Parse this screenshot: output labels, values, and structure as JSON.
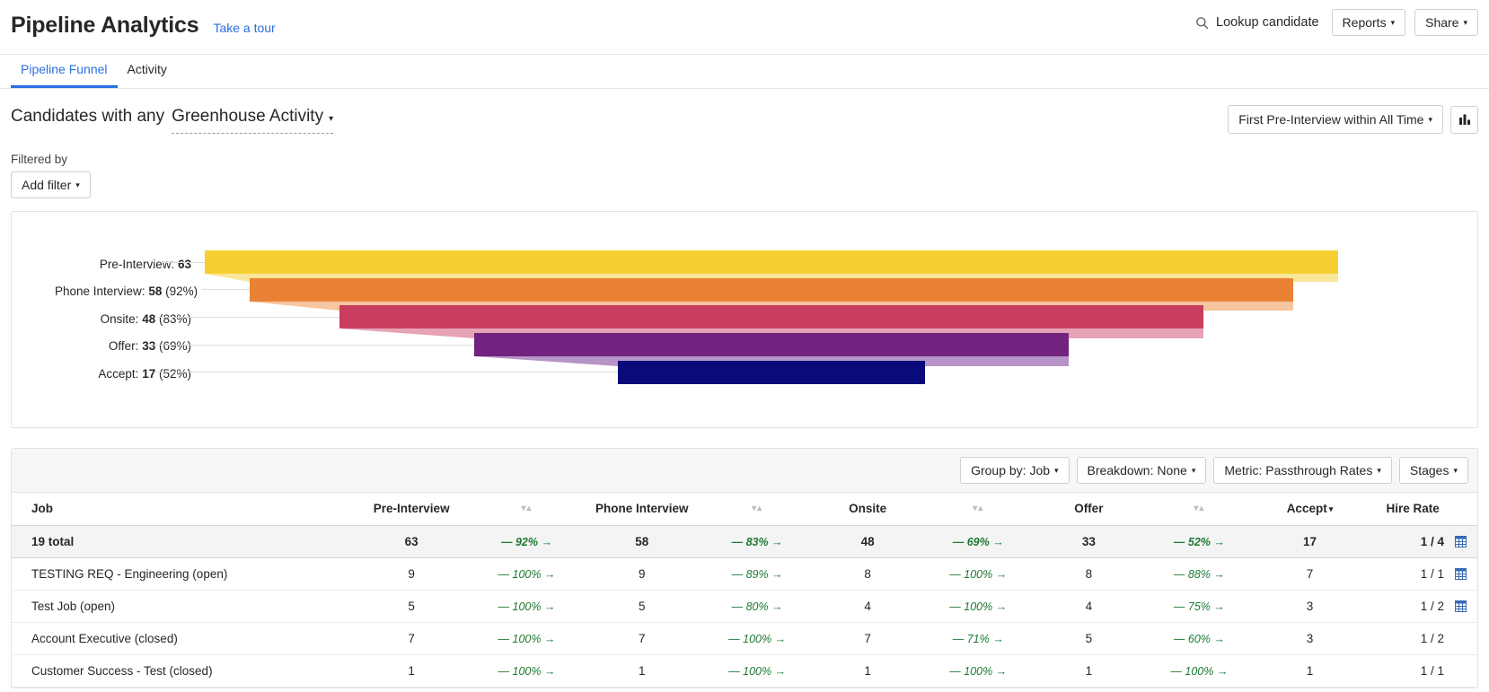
{
  "header": {
    "title": "Pipeline Analytics",
    "tour_link": "Take a tour",
    "lookup_label": "Lookup candidate",
    "search_icon": "search-icon",
    "reports_label": "Reports",
    "share_label": "Share",
    "caret": "▾"
  },
  "tabs": [
    {
      "label": "Pipeline Funnel",
      "active": true
    },
    {
      "label": "Activity",
      "active": false
    }
  ],
  "query": {
    "prefix": "Candidates with any",
    "selector": "Greenhouse Activity",
    "filtered_by": "Filtered by",
    "add_filter": "Add filter",
    "time_selector": "First Pre-Interview within All Time",
    "chart_icon": "bar-chart-icon"
  },
  "chart_data": {
    "type": "bar",
    "title": "",
    "xlabel": "",
    "ylabel": "",
    "orientation": "horizontal-funnel",
    "categories": [
      "Pre-Interview",
      "Phone Interview",
      "Onsite",
      "Offer",
      "Accept"
    ],
    "values": [
      63,
      58,
      48,
      33,
      17
    ],
    "passthrough": [
      null,
      "92%",
      "83%",
      "69%",
      "52%"
    ],
    "labels": [
      "Pre-Interview: 63",
      "Phone Interview: 58 (92%)",
      "Onsite: 48 (83%)",
      "Offer: 33 (69%)",
      "Accept: 17 (52%)"
    ],
    "colors": [
      "#f6cf33",
      "#ea8235",
      "#c93e5f",
      "#72227f",
      "#0a0a7a"
    ],
    "connector_colors": [
      "#fae79b",
      "#f5c6a0",
      "#e6a3b6",
      "#b794c7",
      "#9a9ad0"
    ],
    "grid": false,
    "legend": "none"
  },
  "table_controls": {
    "group_by": "Group by: Job",
    "breakdown": "Breakdown: None",
    "metric": "Metric: Passthrough Rates",
    "stages": "Stages"
  },
  "table": {
    "columns": [
      "Job",
      "Pre-Interview",
      "",
      "Phone Interview",
      "",
      "Onsite",
      "",
      "Offer",
      "",
      "Accept",
      "Hire Rate"
    ],
    "sort_indicator": "▾▴",
    "accept_sorted_caret": "▾",
    "rows": [
      {
        "job": "19 total",
        "total": true,
        "pre": "63",
        "p1": "92%",
        "phone": "58",
        "p2": "83%",
        "onsite": "48",
        "p3": "69%",
        "offer": "33",
        "p4": "52%",
        "accept": "17",
        "hire": "1 / 4",
        "has_grid_icon": true
      },
      {
        "job": "TESTING REQ - Engineering (open)",
        "total": false,
        "pre": "9",
        "p1": "100%",
        "phone": "9",
        "p2": "89%",
        "onsite": "8",
        "p3": "100%",
        "offer": "8",
        "p4": "88%",
        "accept": "7",
        "hire": "1 / 1",
        "has_grid_icon": true
      },
      {
        "job": "Test Job (open)",
        "total": false,
        "pre": "5",
        "p1": "100%",
        "phone": "5",
        "p2": "80%",
        "onsite": "4",
        "p3": "100%",
        "offer": "4",
        "p4": "75%",
        "accept": "3",
        "hire": "1 / 2",
        "has_grid_icon": true
      },
      {
        "job": "Account Executive (closed)",
        "total": false,
        "pre": "7",
        "p1": "100%",
        "phone": "7",
        "p2": "100%",
        "onsite": "7",
        "p3": "71%",
        "offer": "5",
        "p4": "60%",
        "accept": "3",
        "hire": "1 / 2",
        "has_grid_icon": false
      },
      {
        "job": "Customer Success - Test (closed)",
        "total": false,
        "pre": "1",
        "p1": "100%",
        "phone": "1",
        "p2": "100%",
        "onsite": "1",
        "p3": "100%",
        "offer": "1",
        "p4": "100%",
        "accept": "1",
        "hire": "1 / 1",
        "has_grid_icon": false
      }
    ]
  },
  "colors": {
    "accent": "#2b6ee0",
    "positive": "#1e7a34",
    "text": "#272727",
    "border": "#e2e2e2"
  }
}
